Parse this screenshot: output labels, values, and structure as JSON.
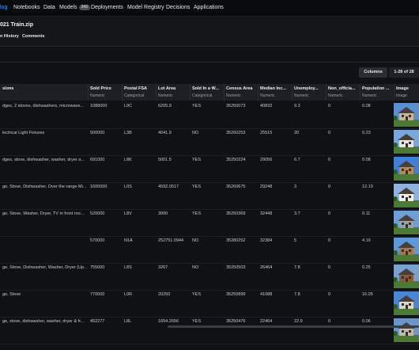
{
  "nav": {
    "items": [
      {
        "label": "log",
        "active": true
      },
      {
        "label": "Notebooks"
      },
      {
        "label": "Data"
      },
      {
        "label": "Models",
        "badge": "343"
      },
      {
        "label": "Deployments"
      },
      {
        "label": "Model Registry"
      },
      {
        "label": "Decisions"
      },
      {
        "label": "Applications"
      }
    ]
  },
  "dataset": {
    "title": "021 Train.zip",
    "tabs": [
      "n History",
      "Comments"
    ]
  },
  "toolbar": {
    "columns_label": "Columns",
    "rows_info": "1-28 of 28"
  },
  "columns": [
    {
      "name": "sions",
      "type": ""
    },
    {
      "name": "Sold Price",
      "type": "Numeric"
    },
    {
      "name": "Postal FSA",
      "type": "Categorical"
    },
    {
      "name": "Lot Area",
      "type": "Numeric"
    },
    {
      "name": "Sold In a W...",
      "type": "Categorical"
    },
    {
      "name": "Census Area",
      "type": "Numeric"
    },
    {
      "name": "Median Inc...",
      "type": "Numeric"
    },
    {
      "name": "Unemploy...",
      "type": "Numeric"
    },
    {
      "name": "Non_officia...",
      "type": "Numeric"
    },
    {
      "name": "Population ...",
      "type": "Numeric"
    },
    {
      "name": "Image",
      "type": "Image"
    }
  ],
  "rows": [
    {
      "cells": [
        "dges, 2 stoves, dishwashers, microwave...",
        "1088000",
        "L9C",
        "6205.9",
        "YES",
        "35250073",
        "40832",
        "9.3",
        "0",
        "0.08"
      ],
      "image": "house-photo-icon"
    },
    {
      "cells": [
        "lectrical Light Fixtures",
        "500000",
        "L3B",
        "4041.9",
        "NO",
        "35260253",
        "25515",
        "20",
        "0",
        "0.23"
      ],
      "image": "house-photo-icon"
    },
    {
      "cells": [
        "dges, stove, dishwasher, washer, dryer a...",
        "691000",
        "L8K",
        "5001.5",
        "YES",
        "35250224",
        "29056",
        "6.7",
        "0",
        "0.08"
      ],
      "image": "house-photo-icon"
    },
    {
      "cells": [
        "ge, Stove, Dishwasher, Over the range Mi...",
        "1600000",
        "L0S",
        "4592.0517",
        "YES",
        "35260675",
        "29248",
        "3",
        "0",
        "12.19"
      ],
      "image": "house-photo-icon"
    },
    {
      "cells": [
        "ge, Stove, Washer, Dryer, TV in front roo...",
        "520000",
        "L8V",
        "3000",
        "YES",
        "35250369",
        "32448",
        "3.7",
        "0",
        "0.11"
      ],
      "image": "house-photo-icon"
    },
    {
      "cells": [
        "",
        "570000",
        "N1A",
        "252751.0944",
        "NO",
        "35280252",
        "32384",
        "5",
        "0",
        "4.19"
      ],
      "image": "house-photo-icon"
    },
    {
      "cells": [
        "ge, Stove, Dishwasher, Washer, Dryer (Up...",
        "755000",
        "L8S",
        "3267",
        "NO",
        "35250503",
        "26464",
        "7.8",
        "0",
        "0.25"
      ],
      "image": "house-photo-icon"
    },
    {
      "cells": [
        "ge, Stove",
        "770000",
        "L0R",
        "20250",
        "YES",
        "35250899",
        "41088",
        "7.8",
        "0",
        "16.05"
      ],
      "image": "house-photo-icon"
    },
    {
      "cells": [
        "ge, stove, dishwasher, washer, dryer & fr...",
        "452277",
        "L8L",
        "1654.2656",
        "YES",
        "35250476",
        "22464",
        "22.9",
        "0",
        "0.06"
      ],
      "image": "house-photo-icon"
    }
  ],
  "colors": {
    "background": "#0f1114",
    "header": "#1c1f24",
    "accent": "#4c9cff"
  }
}
